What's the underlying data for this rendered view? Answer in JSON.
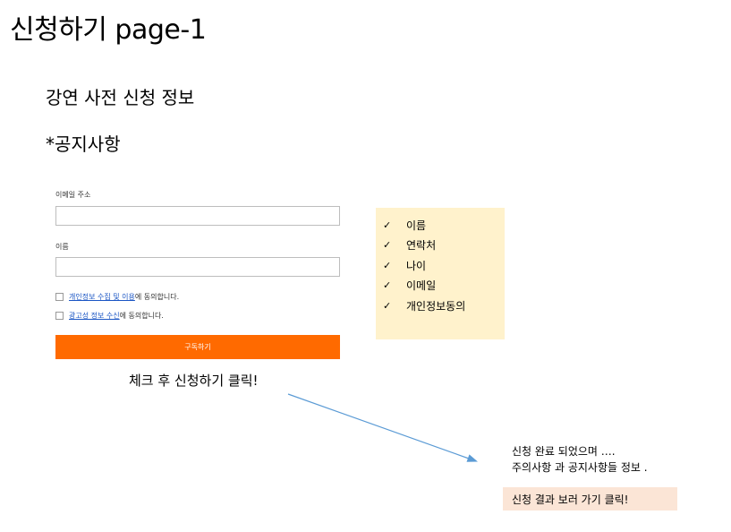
{
  "page": {
    "title": "신청하기 page-1",
    "section_title": "강연 사전 신청 정보",
    "notice_title": "*공지사항"
  },
  "form": {
    "email_label": "이메일 주소",
    "email_value": "",
    "name_label": "이름",
    "name_value": "",
    "privacy_link": "개인정보 수집 및 이용",
    "privacy_suffix": "에 동의합니다.",
    "ads_link": "광고성 정보 수신",
    "ads_suffix": "에 동의합니다.",
    "submit_label": "구독하기"
  },
  "caption": "체크 후 신청하기 클릭!",
  "required_items": [
    "이름",
    "연락처",
    "나이",
    "이메일",
    "개인정보동의"
  ],
  "check_glyph": "✓",
  "result": {
    "line1": "신청 완료 되었으며 ….",
    "line2": "주의사항 과 공지사항들 정보 .",
    "button_label": "신청 결과 보러 가기 클릭!"
  },
  "colors": {
    "accent": "#ff6a00",
    "note_bg": "#fff2cc",
    "result_bg": "#fbe5d6",
    "arrow": "#5b9bd5"
  }
}
